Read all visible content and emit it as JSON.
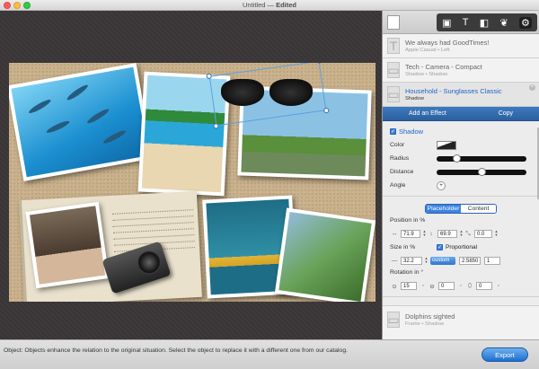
{
  "window": {
    "title_prefix": "Untitled",
    "separator": " — ",
    "title_suffix": "Edited"
  },
  "toolbar": {
    "icons": [
      "add-photo-icon",
      "add-text-icon",
      "add-object-icon",
      "add-shape-icon",
      "settings-gear-icon"
    ],
    "glyphs": {
      "photo": "▣",
      "text": "T",
      "object": "◧",
      "shape": "❦",
      "gear": "⚙"
    }
  },
  "layers": [
    {
      "title": "We always had GoodTimes!",
      "subtitle": "Apple Casual • Left",
      "glyph": "T"
    },
    {
      "title": "Tech - Camera - Compact",
      "subtitle": "Shadow • Shadow",
      "glyph": "▭"
    },
    {
      "title": "Household - Sunglasses Classic",
      "subtitle": "Shadow",
      "glyph": "▭"
    }
  ],
  "actions": {
    "add_effect": "Add an Effect",
    "copy": "Copy"
  },
  "shadow": {
    "title": "Shadow",
    "color_label": "Color",
    "radius_label": "Radius",
    "radius_value": 0.2,
    "distance_label": "Distance",
    "distance_value": 0.5,
    "angle_label": "Angle",
    "angle_glyph": "+"
  },
  "tabs": {
    "placeholder": "Placeholder",
    "content": "Content"
  },
  "position": {
    "label": "Position in %",
    "x": "71.9",
    "y": "69.9",
    "z": "0.0"
  },
  "size": {
    "label": "Size in %",
    "proportional": "Proportional",
    "width": "32.2",
    "mode": "custom",
    "ratio": "2.5850",
    "ratio2": "1"
  },
  "rotation": {
    "label": "Rotation in °",
    "x": "15",
    "y": "0",
    "z": "0"
  },
  "bottom_layer": {
    "title": "Dolphins sighted",
    "subtitle": "Frame • Shadow",
    "glyph": "▭"
  },
  "status": {
    "text": "Object: Objects enhance the relation to the original situation. Select the object to replace it with a different one from our catalog.",
    "export": "Export"
  },
  "notebook_lines": [
    "We always had Goodtimes",
    "Holiday was wonderful",
    "more lines of notes",
    "the beach was great",
    "and the dolphins too",
    "we will come back",
    "the end"
  ]
}
